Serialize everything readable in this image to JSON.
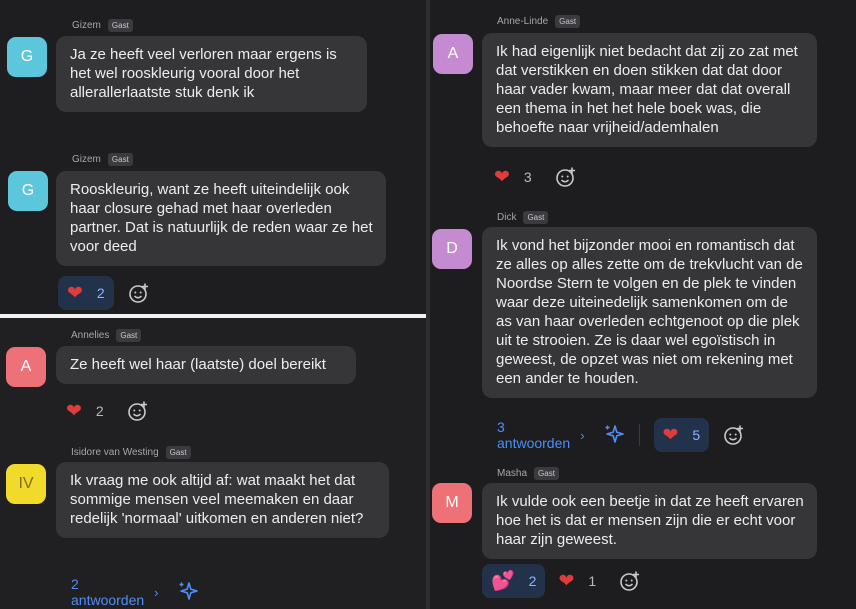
{
  "colors": {
    "teal_avatar": "#5cc7dc",
    "rose_avatar": "#ee7178",
    "yellow_avatar": "#f1da2a",
    "purple_avatar": "#c48bd1",
    "bubble": "#363639",
    "link": "#4e8ef7",
    "heart": "#e23b3b"
  },
  "guest_badge": "Gast",
  "left_top": [
    {
      "author": "Gizem",
      "initials": "G",
      "text": "Ja ze heeft veel verloren maar ergens is het wel rooskleurig vooral door het allerallerlaatste stuk denk ik"
    },
    {
      "author": "Gizem",
      "initials": "G",
      "text": "Rooskleurig, want ze heeft uiteindelijk ook haar closure gehad met haar overleden partner. Dat is natuurlijk de reden waar ze het voor deed",
      "reaction_count": "2"
    }
  ],
  "left_bottom": [
    {
      "author": "Annelies",
      "initials": "A",
      "text": "Ze heeft wel haar (laatste) doel bereikt",
      "reaction_count": "2"
    },
    {
      "author": "Isidore van Westing",
      "initials": "IV",
      "text": "Ik vraag me ook altijd af: wat maakt het dat sommige mensen veel meemaken en daar redelijk 'normaal' uitkomen en anderen niet?",
      "replies": "2 antwoorden"
    }
  ],
  "right": [
    {
      "author": "Anne-Linde",
      "initials": "A",
      "text": "Ik had eigenlijk niet bedacht dat zij zo zat met dat verstikken en doen stikken dat dat door haar vader kwam, maar meer dat dat overall een thema in het het hele boek was, die behoefte naar vrijheid/ademhalen",
      "reaction_count": "3"
    },
    {
      "author": "Dick",
      "initials": "D",
      "text": "Ik vond het bijzonder mooi en romantisch dat ze alles op alles zette om de trekvlucht van de Noordse Stern te volgen en de plek te vinden waar deze uiteinedelijk samenkomen om de as van haar overleden echtgenoot op die plek uit te strooien. Ze is daar wel egoïstisch in geweest, de opzet was niet om rekening met een ander te houden.",
      "replies": "3 antwoorden",
      "reaction_count": "5"
    },
    {
      "author": "Masha",
      "initials": "M",
      "text": "Ik vulde ook een beetje in dat ze heeft ervaren hoe het is dat er mensen zijn die er echt voor haar zijn geweest.",
      "reaction_count_1": "2",
      "reaction_count_2": "1"
    }
  ]
}
